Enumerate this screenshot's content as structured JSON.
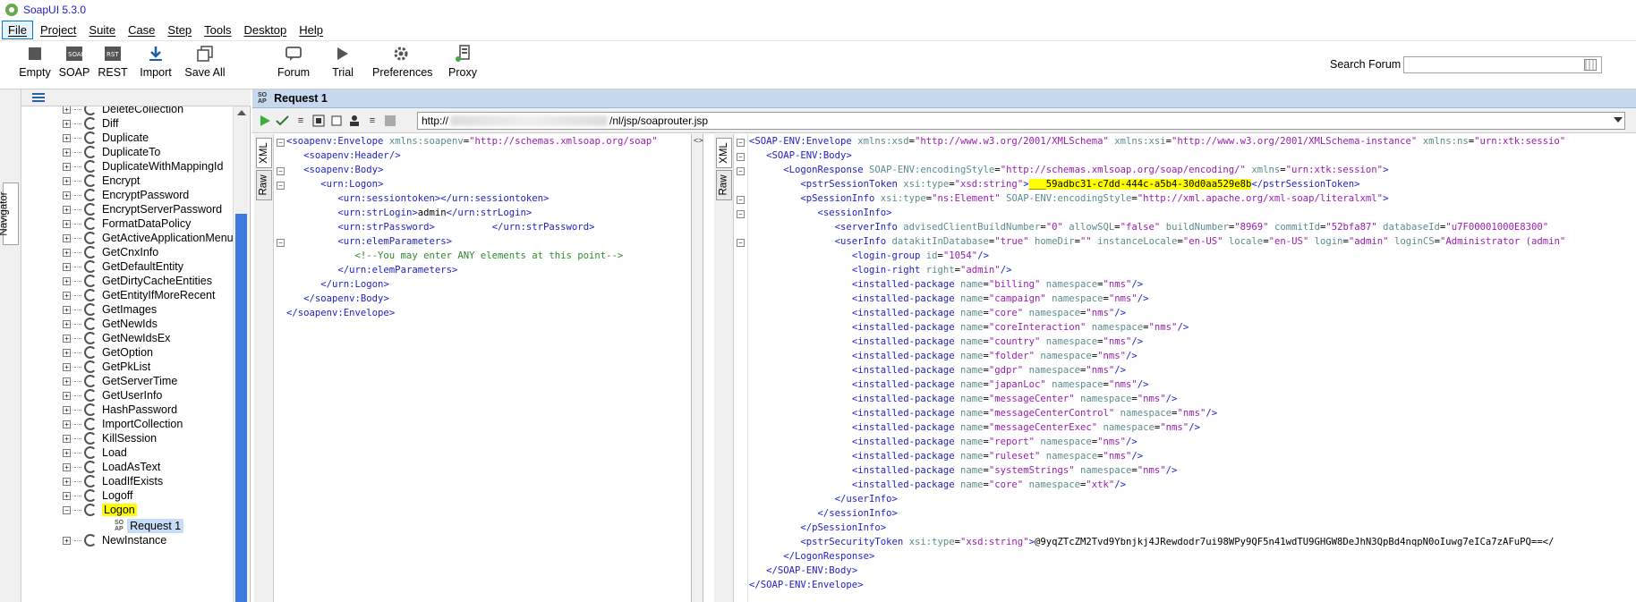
{
  "window": {
    "title": "SoapUI 5.3.0"
  },
  "menu": [
    "File",
    "Project",
    "Suite",
    "Case",
    "Step",
    "Tools",
    "Desktop",
    "Help"
  ],
  "toolbar": {
    "empty": "Empty",
    "soap": "SOAP",
    "rest": "REST",
    "import": "Import",
    "saveall": "Save All",
    "forum": "Forum",
    "trial": "Trial",
    "preferences": "Preferences",
    "proxy": "Proxy"
  },
  "search": {
    "label": "Search Forum",
    "value": ""
  },
  "navigator": {
    "tab": "Navigator"
  },
  "tree": {
    "items": [
      "DeleteCollection",
      "Diff",
      "Duplicate",
      "DuplicateTo",
      "DuplicateWithMappingId",
      "Encrypt",
      "EncryptPassword",
      "EncryptServerPassword",
      "FormatDataPolicy",
      "GetActiveApplicationMenus",
      "GetCnxInfo",
      "GetDefaultEntity",
      "GetDirtyCacheEntities",
      "GetEntityIfMoreRecent",
      "GetImages",
      "GetNewIds",
      "GetNewIdsEx",
      "GetOption",
      "GetPkList",
      "GetServerTime",
      "GetUserInfo",
      "HashPassword",
      "ImportCollection",
      "KillSession",
      "Load",
      "LoadAsText",
      "LoadIfExists",
      "Logoff",
      "Logon",
      "NewInstance"
    ],
    "selected": "Logon",
    "subitem": "Request 1"
  },
  "request": {
    "title": "Request 1",
    "url_prefix": "http://",
    "url_suffix": "/nl/jsp/soaprouter.jsp",
    "left_tabs": [
      "XML",
      "Raw"
    ],
    "right_tabs": [
      "XML",
      "Raw"
    ]
  },
  "request_xml": [
    "<soapenv:Envelope xmlns:soapenv=\"http://schemas.xmlsoap.org/soap",
    "   <soapenv:Header/>",
    "   <soapenv:Body>",
    "      <urn:Logon>",
    "         <urn:sessiontoken></urn:sessiontoken>",
    "         <urn:strLogin>admin</urn:strLogin>",
    "         <urn:strPassword>          </urn:strPassword>",
    "         <urn:elemParameters>",
    "            <!--You may enter ANY elements at this point-->",
    "         </urn:elemParameters>",
    "      </urn:Logon>",
    "   </soapenv:Body>",
    "</soapenv:Envelope>"
  ],
  "response_xml": [
    "<SOAP-ENV:Envelope xmlns:xsd=\"http://www.w3.org/2001/XMLSchema\" xmlns:xsi=\"http://www.w3.org/2001/XMLSchema-instance\" xmlns:ns=\"urn:xtk:sessio",
    "   <SOAP-ENV:Body>",
    "      <LogonResponse SOAP-ENV:encodingStyle=\"http://schemas.xmlsoap.org/soap/encoding/\" xmlns=\"urn:xtk:session\">",
    "         <pstrSessionToken xsi:type=\"xsd:string\">___59adbc31-c7dd-444c-a5b4-30d0aa529e8b</pstrSessionToken>",
    "         <pSessionInfo xsi:type=\"ns:Element\" SOAP-ENV:encodingStyle=\"http://xml.apache.org/xml-soap/literalxml\">",
    "            <sessionInfo>",
    "               <serverInfo advisedClientBuildNumber=\"0\" allowSQL=\"false\" buildNumber=\"8969\" commitId=\"52bfa87\" databaseId=\"u7F00001000E8300\"",
    "               <userInfo datakitInDatabase=\"true\" homeDir=\"\" instanceLocale=\"en-US\" locale=\"en-US\" login=\"admin\" loginCS=\"Administrator (admin",
    "                  <login-group id=\"1054\"/>",
    "                  <login-right right=\"admin\"/>",
    "                  <installed-package name=\"billing\" namespace=\"nms\"/>",
    "                  <installed-package name=\"campaign\" namespace=\"nms\"/>",
    "                  <installed-package name=\"core\" namespace=\"nms\"/>",
    "                  <installed-package name=\"coreInteraction\" namespace=\"nms\"/>",
    "                  <installed-package name=\"country\" namespace=\"nms\"/>",
    "                  <installed-package name=\"folder\" namespace=\"nms\"/>",
    "                  <installed-package name=\"gdpr\" namespace=\"nms\"/>",
    "                  <installed-package name=\"japanLoc\" namespace=\"nms\"/>",
    "                  <installed-package name=\"messageCenter\" namespace=\"nms\"/>",
    "                  <installed-package name=\"messageCenterControl\" namespace=\"nms\"/>",
    "                  <installed-package name=\"messageCenterExec\" namespace=\"nms\"/>",
    "                  <installed-package name=\"report\" namespace=\"nms\"/>",
    "                  <installed-package name=\"ruleset\" namespace=\"nms\"/>",
    "                  <installed-package name=\"systemStrings\" namespace=\"nms\"/>",
    "                  <installed-package name=\"core\" namespace=\"xtk\"/>",
    "               </userInfo>",
    "            </sessionInfo>",
    "         </pSessionInfo>",
    "         <pstrSecurityToken xsi:type=\"xsd:string\">@9yqZTcZM2Tvd9Ybnjkj4JRewdodr7ui98WPy9QF5n41wdTU9GHGW8DeJhN3QpBd4nqpN0oIuwg7eICa7zAFuPQ==</",
    "      </LogonResponse>",
    "   </SOAP-ENV:Body>",
    "</SOAP-ENV:Envelope>"
  ],
  "colors": {
    "tag": "#2020c8",
    "attr": "#5a8c8c",
    "value": "#9b1bb0",
    "comment": "#2d8a2d",
    "highlight": "#ffff00",
    "selection": "#c7dcf5"
  }
}
